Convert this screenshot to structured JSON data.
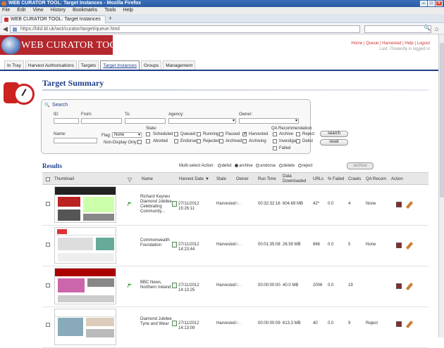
{
  "browser": {
    "window_title": "WEB CURATOR TOOL: Target Instances - Mozilla Firefox",
    "menus": [
      "File",
      "Edit",
      "View",
      "History",
      "Bookmarks",
      "Tools",
      "Help"
    ],
    "tab_label": "WEB CURATOR TOOL: Target Instances",
    "new_tab": "+",
    "url": "https://ldsl.bl.uk/wct/curator/target/queue.html",
    "nav_back": "◀",
    "nav_reload": "↻",
    "nav_home": "⌂",
    "search_icon": "🔍"
  },
  "header": {
    "logo_text": "WEB CURATOR TOOL",
    "links": "Home | Queue | Harvested | Help | Logout",
    "user_line": "Last: iTowardly is logged in"
  },
  "tabs": [
    {
      "label": "In Tray",
      "active": false
    },
    {
      "label": "Harvest Authorisations",
      "active": false
    },
    {
      "label": "Targets",
      "active": false
    },
    {
      "label": "Target Instances",
      "active": true
    },
    {
      "label": "Groups",
      "active": false
    },
    {
      "label": "Management",
      "active": false
    }
  ],
  "page_title": "Target Summary",
  "search": {
    "heading": "Search",
    "fields": {
      "id": "ID:",
      "from": "From:",
      "to": "To:",
      "agency": "Agency:",
      "owner": "Owner:",
      "name": "Name:",
      "flag": "Flag:",
      "flag_value": "None",
      "non_display_only": "Non-Display Only:",
      "state": "State:",
      "qa_recommendation": "QA Recommendation:"
    },
    "states": [
      {
        "label": "Scheduled",
        "checked": false
      },
      {
        "label": "Queued",
        "checked": false
      },
      {
        "label": "Running",
        "checked": false
      },
      {
        "label": "Paused",
        "checked": false
      },
      {
        "label": "Harvested",
        "checked": true
      },
      {
        "label": "Aborted",
        "checked": false
      },
      {
        "label": "Endorsed",
        "checked": false
      },
      {
        "label": "Rejected",
        "checked": false
      },
      {
        "label": "Archived",
        "checked": false
      },
      {
        "label": "Archiving",
        "checked": false
      }
    ],
    "qa": [
      {
        "label": "Archive",
        "checked": false
      },
      {
        "label": "Reject",
        "checked": false
      },
      {
        "label": "Investigate",
        "checked": false
      },
      {
        "label": "Delist",
        "checked": false
      },
      {
        "label": "Failed",
        "checked": false
      }
    ],
    "buttons": {
      "search": "search",
      "reset": "reset"
    }
  },
  "results": {
    "heading": "Results",
    "multi_action_label": "Multi-select Action:",
    "actions": [
      {
        "label": "delist",
        "selected": false
      },
      {
        "label": "archive",
        "selected": true
      },
      {
        "label": "endorse",
        "selected": false
      },
      {
        "label": "delete",
        "selected": false
      },
      {
        "label": "reject",
        "selected": false
      }
    ],
    "action_button": "archive",
    "columns": [
      "Thumbnail",
      "Name",
      "Harvest Date",
      "State",
      "Owner",
      "Run Time",
      "Data Downloaded",
      "URLs",
      "% Failed",
      "Crawls",
      "QA Recom",
      "Action"
    ],
    "rows": [
      {
        "name": "Richard Keynes Diamond Jubilee Celebrating Community...",
        "date": "27/11/2012 15:26:11",
        "state": "Harvested",
        "owner": "b...",
        "runtime": "00:32:32:16",
        "data": "604.69 MB",
        "urls": "42*",
        "failed": "0.0",
        "crawls": "4",
        "qa": "None",
        "flagged": true
      },
      {
        "name": "Commonwealth Foundation",
        "date": "27/11/2012 14:23:44",
        "state": "Harvested",
        "owner": "b...",
        "runtime": "00:01:35:08",
        "data": "26.59 MB",
        "urls": "866",
        "failed": "0.0",
        "crawls": "5",
        "qa": "None",
        "flagged": false
      },
      {
        "name": "BBC News, Northern Ireland",
        "date": "27/11/2012 14:13:25",
        "state": "Harvested",
        "owner": "b...",
        "runtime": "00:00:00:00",
        "data": "40.0 MB",
        "urls": "2006",
        "failed": "0.0",
        "crawls": "19",
        "qa": "",
        "flagged": true
      },
      {
        "name": "Diamond Jubilee Tyne and Wear",
        "date": "27/11/2012 14:13:09",
        "state": "Harvested",
        "owner": "b...",
        "runtime": "00:00:00:09",
        "data": "613.3 MB",
        "urls": "40",
        "failed": "0.0",
        "crawls": "9",
        "qa": "Reject",
        "flagged": false
      }
    ]
  },
  "colors": {
    "brand_red": "#b4272d",
    "nav_blue": "#1d3e8a",
    "link_red": "#cc3333",
    "flag_green": "#2a9a2a"
  }
}
